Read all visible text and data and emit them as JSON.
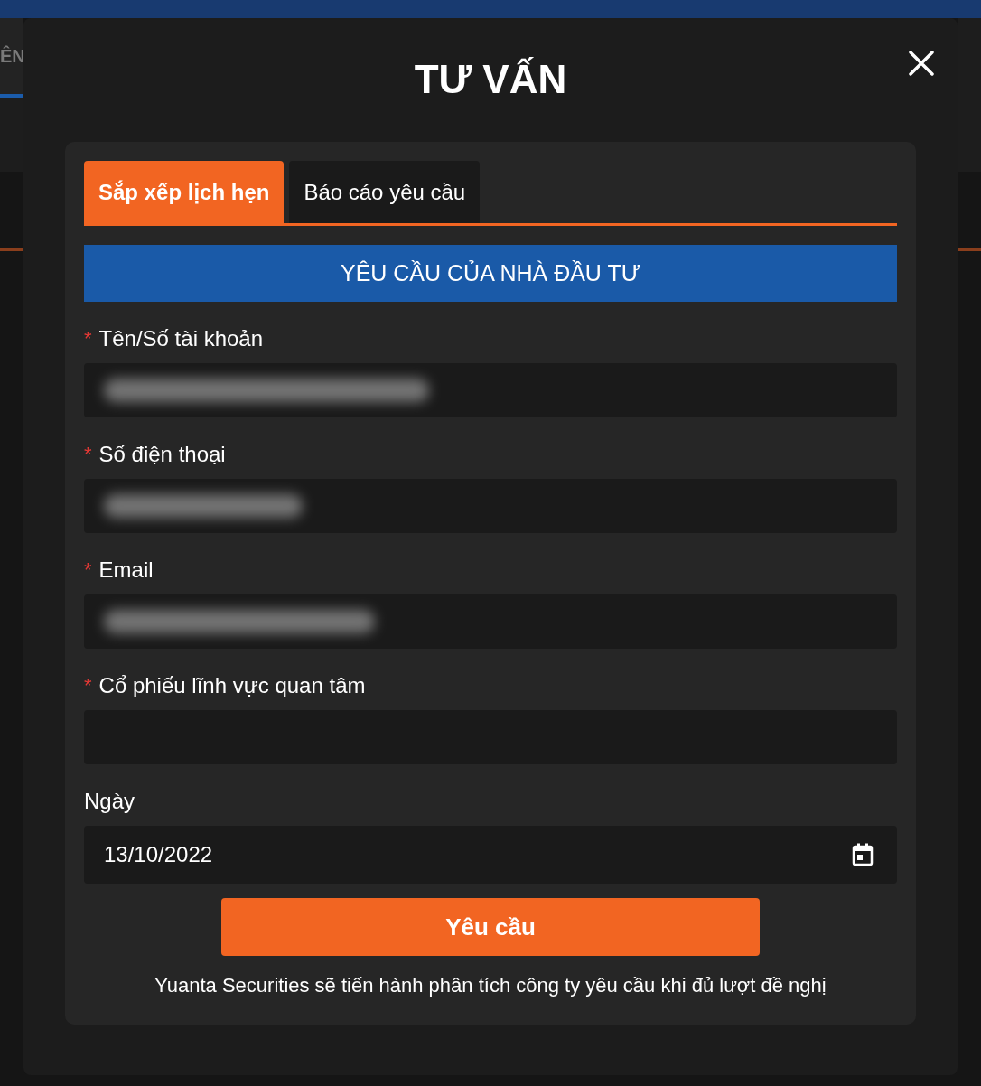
{
  "background": {
    "nav_text": "ÊN"
  },
  "dialog": {
    "title": "TƯ VẤN",
    "tabs": [
      {
        "label": "Sắp xếp lịch hẹn",
        "selected": true
      },
      {
        "label": "Báo cáo yêu cầu",
        "selected": false
      }
    ],
    "banner": "YÊU CẦU CỦA NHÀ ĐẦU TƯ",
    "fields": [
      {
        "marker": "*",
        "label": "Tên/Số tài khoản",
        "kind": "blurred"
      },
      {
        "marker": "*",
        "label": "Số điện thoại",
        "kind": "blurred"
      },
      {
        "marker": "*",
        "label": "Email",
        "kind": "blurred"
      },
      {
        "marker": "*",
        "label": "Cổ phiếu lĩnh vực quan tâm",
        "kind": "empty"
      },
      {
        "label": "Ngày",
        "kind": "date",
        "value": "13/10/2022"
      }
    ],
    "submit": "Yêu cầu",
    "note": "Yuanta Securities sẽ tiến hành phân tích công ty yêu cầu khi đủ lượt đề nghị"
  }
}
